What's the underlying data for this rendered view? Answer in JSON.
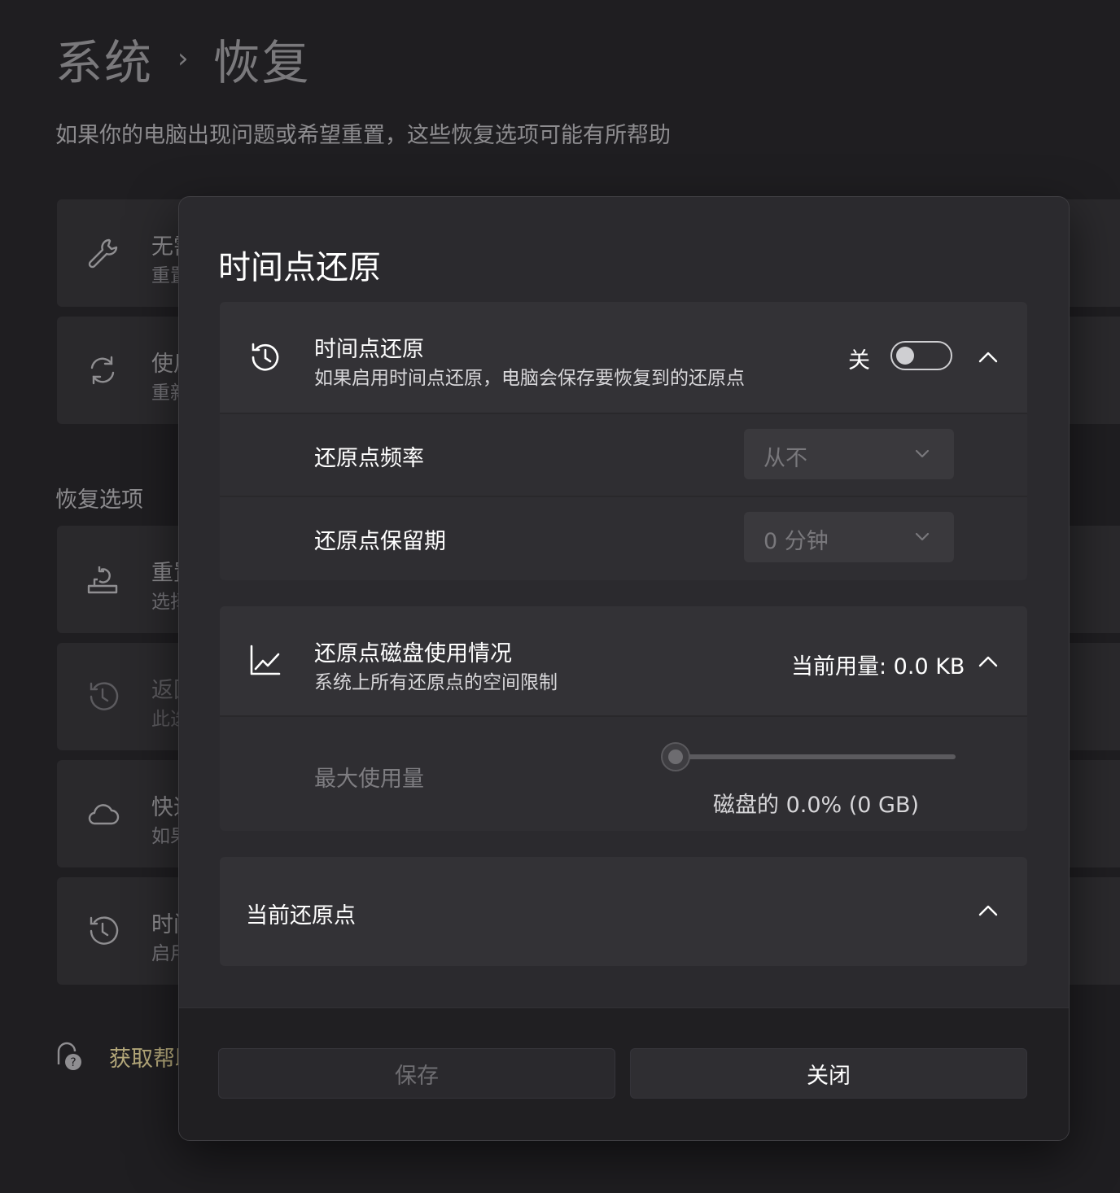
{
  "breadcrumb": {
    "parent": "系统",
    "separator": "›",
    "current": "恢复"
  },
  "page_description": "如果你的电脑出现问题或希望重置，这些恢复选项可能有所帮助",
  "background": {
    "cards": [
      {
        "title": "无需",
        "subtitle": "重置"
      },
      {
        "title": "使用",
        "subtitle": "重新"
      }
    ],
    "section_label": "恢复选项",
    "options": [
      {
        "title": "重置",
        "subtitle": "选择"
      },
      {
        "title": "返回",
        "subtitle": "此选"
      },
      {
        "title": "快速",
        "subtitle": "如果"
      },
      {
        "title": "时间",
        "subtitle": "启用"
      }
    ],
    "help_link": "获取帮助"
  },
  "dialog": {
    "title": "时间点还原",
    "restore_panel": {
      "title": "时间点还原",
      "subtitle": "如果启用时间点还原，电脑会保存要恢复到的还原点",
      "toggle_label": "关",
      "toggle_on": false,
      "frequency": {
        "label": "还原点频率",
        "value": "从不"
      },
      "retention": {
        "label": "还原点保留期",
        "value": "0 分钟"
      }
    },
    "disk_panel": {
      "title": "还原点磁盘使用情况",
      "subtitle": "系统上所有还原点的空间限制",
      "current_usage": "当前用量: 0.0 KB",
      "max_usage_label": "最大使用量",
      "slider_percent": 0,
      "disk_caption": "磁盘的 0.0% (0 GB)"
    },
    "current_points_panel": {
      "title": "当前还原点"
    },
    "buttons": {
      "save": "保存",
      "close": "关闭"
    }
  }
}
